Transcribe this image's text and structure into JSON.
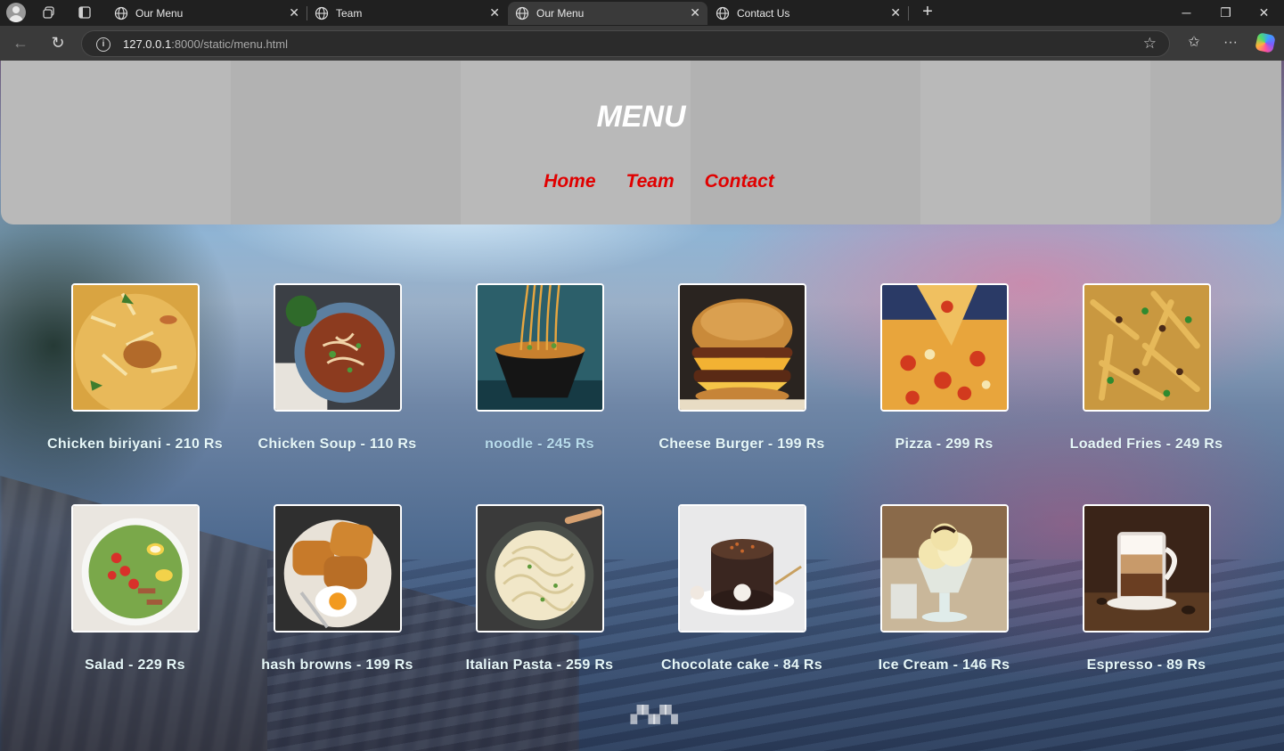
{
  "browser": {
    "tabs": [
      {
        "title": "Our Menu",
        "active": false
      },
      {
        "title": "Team",
        "active": false
      },
      {
        "title": "Our Menu",
        "active": true
      },
      {
        "title": "Contact Us",
        "active": false
      }
    ],
    "address": {
      "host": "127.0.0.1",
      "path": ":8000/static/menu.html"
    }
  },
  "header": {
    "title": "MENU",
    "nav": [
      "Home",
      "Team",
      "Contact"
    ],
    "nav_color": "#e00000"
  },
  "items": [
    {
      "name": "Chicken biriyani - 210 Rs",
      "image": "biriyani-image"
    },
    {
      "name": "Chicken Soup - 110 Rs",
      "image": "soup-image"
    },
    {
      "name": "noodle - 245 Rs",
      "image": "noodle-image"
    },
    {
      "name": "Cheese Burger - 199 Rs",
      "image": "burger-image"
    },
    {
      "name": "Pizza - 299 Rs",
      "image": "pizza-image"
    },
    {
      "name": "Loaded Fries - 249 Rs",
      "image": "fries-image"
    },
    {
      "name": "Salad - 229 Rs",
      "image": "salad-image"
    },
    {
      "name": "hash browns - 199 Rs",
      "image": "hashbrown-image"
    },
    {
      "name": "Italian Pasta - 259 Rs",
      "image": "pasta-image"
    },
    {
      "name": "Chocolate cake - 84 Rs",
      "image": "cake-image"
    },
    {
      "name": "Ice Cream - 146 Rs",
      "image": "icecream-image"
    },
    {
      "name": "Espresso - 89 Rs",
      "image": "espresso-image"
    }
  ]
}
